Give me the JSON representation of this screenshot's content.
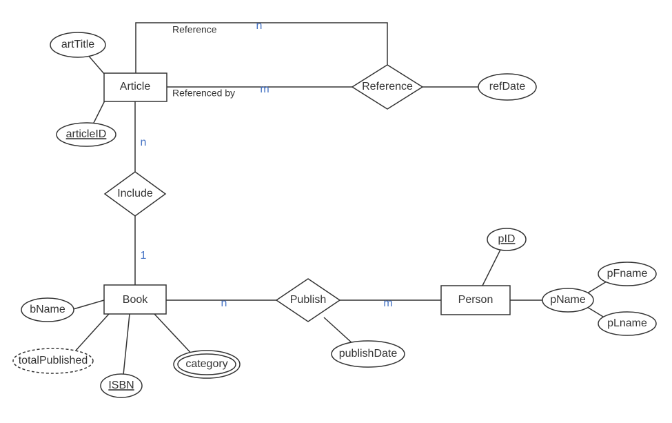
{
  "entities": {
    "article": {
      "label": "Article"
    },
    "book": {
      "label": "Book"
    },
    "person": {
      "label": "Person"
    }
  },
  "relationships": {
    "reference": {
      "label": "Reference",
      "roleTop": "Reference",
      "roleBottom": "Referenced by"
    },
    "include": {
      "label": "Include"
    },
    "publish": {
      "label": "Publish"
    }
  },
  "attributes": {
    "artTitle": "artTitle",
    "articleID": "articleID",
    "refDate": "refDate",
    "bName": "bName",
    "totalPublished": "totalPublished",
    "ISBN": "ISBN",
    "category": "category",
    "publishDate": "publishDate",
    "pID": "pID",
    "pName": "pName",
    "pFname": "pFname",
    "pLname": "pLname"
  },
  "cardinalities": {
    "articleReferenceTop": "n",
    "articleReferenceBottom": "m",
    "articleInclude": "n",
    "bookInclude": "1",
    "bookPublish": "n",
    "personPublish": "m"
  }
}
